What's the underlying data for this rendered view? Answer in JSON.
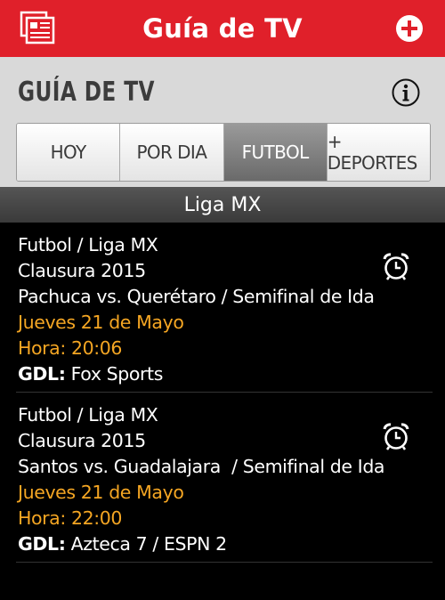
{
  "app": {
    "title": "Guía de TV"
  },
  "header": {
    "page_title": "GUÍA DE TV"
  },
  "tabs": [
    {
      "label": "HOY"
    },
    {
      "label": "POR DIA"
    },
    {
      "label": "FUTBOL"
    },
    {
      "label": "+ DEPORTES"
    }
  ],
  "active_tab": "FUTBOL",
  "section": {
    "title": "Liga MX"
  },
  "events": [
    {
      "category": "Futbol / Liga MX",
      "tournament": "Clausura 2015",
      "match": "Pachuca vs. Querétaro / Semifinal de Ida",
      "date": "Jueves 21 de Mayo",
      "time": "Hora: 20:06",
      "city": "GDL:",
      "channels": "Fox Sports"
    },
    {
      "category": "Futbol / Liga MX",
      "tournament": "Clausura 2015",
      "match": "Santos vs. Guadalajara  / Semifinal de Ida",
      "date": "Jueves 21 de Mayo",
      "time": "Hora: 22:00",
      "city": "GDL:",
      "channels": "Azteca 7 / ESPN 2"
    }
  ],
  "colors": {
    "topbar": "#e0202a",
    "accent": "#f5a623",
    "header_bg": "#d9d9d9"
  },
  "icons": {
    "menu": "newspaper-icon",
    "add": "plus-circle-icon",
    "info": "info-icon",
    "alarm": "alarm-clock-icon"
  }
}
